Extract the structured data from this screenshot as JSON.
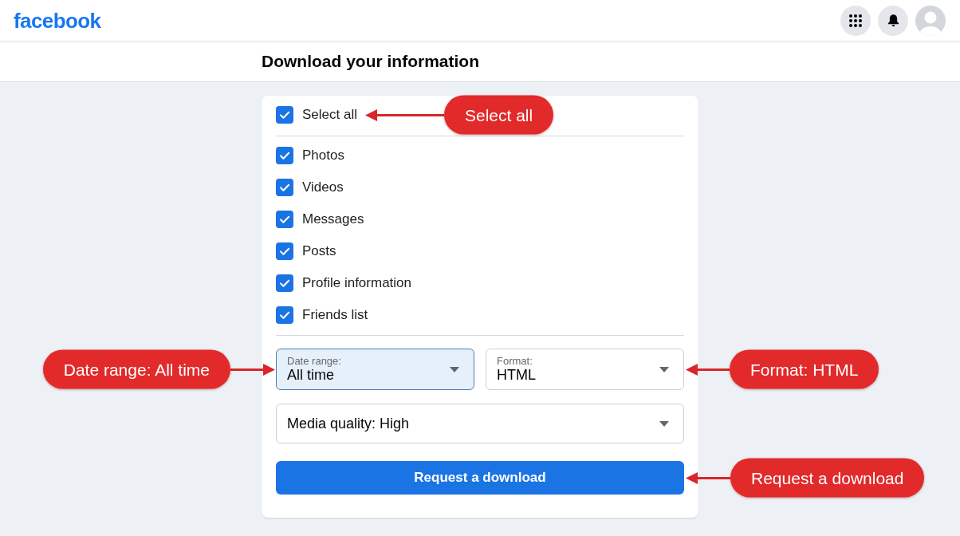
{
  "header": {
    "logo": "facebook"
  },
  "page_title": "Download your information",
  "form": {
    "select_all": {
      "label": "Select all",
      "checked": true,
      "callout": "Select all"
    },
    "categories": [
      {
        "label": "Photos",
        "checked": true
      },
      {
        "label": "Videos",
        "checked": true
      },
      {
        "label": "Messages",
        "checked": true
      },
      {
        "label": "Posts",
        "checked": true
      },
      {
        "label": "Profile information",
        "checked": true
      },
      {
        "label": "Friends list",
        "checked": true
      }
    ],
    "selects": [
      {
        "label": "Date range:",
        "value": "All time",
        "focused": true,
        "callout": "Date range: All time"
      },
      {
        "label": "Format:",
        "value": "HTML",
        "focused": false,
        "callout": "Format: HTML"
      }
    ],
    "media_quality": {
      "value": "Media quality: High"
    },
    "submit": {
      "label": "Request a download",
      "callout": "Request a download"
    }
  }
}
